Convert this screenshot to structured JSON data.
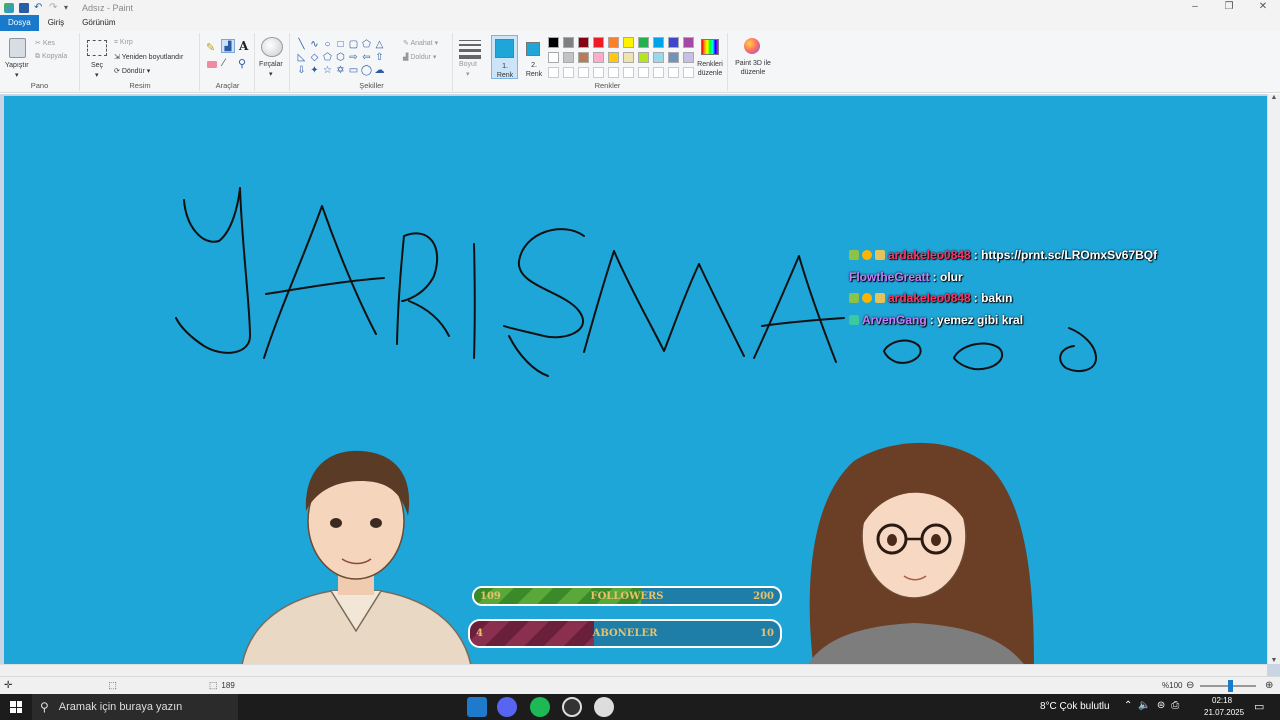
{
  "window": {
    "title": "Adsız - Paint"
  },
  "tabs": [
    "Dosya",
    "Giriş",
    "Görünüm"
  ],
  "ribbon": {
    "clipboard": {
      "paste": "Yapıştır",
      "cut": "Kes",
      "copy": "Kopyala",
      "label": "Pano"
    },
    "image": {
      "select": "Seç",
      "crop": "Kırp",
      "resize": "Yeniden boyutlandır",
      "rotate": "Döndür",
      "label": "Resim"
    },
    "tools": {
      "label": "Araçlar"
    },
    "brushes": {
      "label": "Fırçalar"
    },
    "shapes": {
      "outline": "Anahat",
      "fill": "Doldur",
      "label": "Şekiller"
    },
    "size": {
      "label": "Boyut"
    },
    "colors": {
      "color1": "1. Renk",
      "color2": "2. Renk",
      "edit": "Renkleri düzenle",
      "label": "Renkler",
      "color1_hex": "#1ea6d8",
      "color2_hex": "#1ea6d8",
      "palette_row1": [
        "#000000",
        "#7f7f7f",
        "#880015",
        "#ed1c24",
        "#ff7f27",
        "#fff200",
        "#22b14c",
        "#00a2e8",
        "#3f48cc",
        "#a349a4"
      ],
      "palette_row2": [
        "#ffffff",
        "#c3c3c3",
        "#b97a57",
        "#ffaec9",
        "#ffc90e",
        "#efe4b0",
        "#b5e61d",
        "#99d9ea",
        "#7092be",
        "#c8bfe7"
      ]
    },
    "paint3d": {
      "label": "Paint 3D ile düzenle"
    }
  },
  "canvas": {
    "background": "#1ea6d8",
    "drawing_text": "YARIŞMA"
  },
  "chat": [
    {
      "user": "ardakeleo0848",
      "message": ": https://prnt.sc/LROmxSv67BQf",
      "color": "#ff3366"
    },
    {
      "user": "FlowtheGreatt",
      "message": ": olur",
      "color": "#c77dff"
    },
    {
      "user": "ardakeleo0848",
      "message": ": bakın",
      "color": "#ff3366"
    },
    {
      "user": "ArvenGang",
      "message": ": yemez gibi kral",
      "color": "#c77dff"
    }
  ],
  "followers_bar": {
    "current": "109",
    "label": "FOLLOWERS",
    "goal": "200",
    "progress": 0.545
  },
  "subs_bar": {
    "current": "4",
    "label": "ABONELER",
    "goal": "10",
    "progress": 0.4
  },
  "statusbar": {
    "dimensions": "189",
    "zoom": "%100"
  },
  "taskbar": {
    "search_placeholder": "Aramak için buraya yazın",
    "weather": "8°C  Çok bulutlu",
    "time": "02:18",
    "date": "21.07.2025"
  }
}
